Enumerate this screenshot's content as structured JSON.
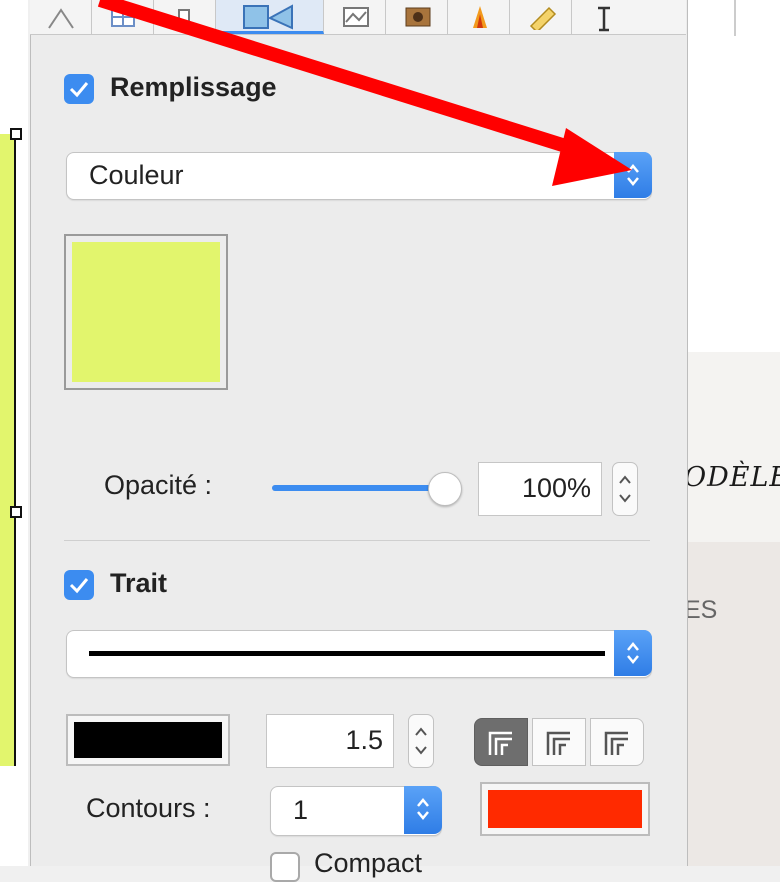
{
  "fill": {
    "enabled": true,
    "section_label": "Remplissage",
    "type_popup_value": "Couleur",
    "swatch_color": "#e2f56d",
    "opacity_label": "Opacité :",
    "opacity_value": "100%",
    "opacity_level": 1.0
  },
  "stroke": {
    "enabled": true,
    "section_label": "Trait",
    "style_popup": "solid-line",
    "color": "#000000",
    "width_value": "1.5",
    "alignment_options": [
      "inner-stroke-icon",
      "center-stroke-icon",
      "outer-stroke-icon"
    ],
    "selected_alignment": "inner-stroke-icon",
    "contours_label": "Contours :",
    "contours_value": "1",
    "contours_color": "#ff2a00"
  },
  "compact_label": "Compact",
  "background_document": {
    "title_fragment": "ODÈLE",
    "subtitle_fragment": "ES"
  },
  "toolbar_icons": [
    "shape-icon",
    "grid-icon",
    "fill-stroke-icon",
    "image-icon",
    "photo-icon",
    "effects-icon",
    "ruler-icon",
    "text-icon"
  ],
  "annotation": {
    "arrow_color": "#ff0000"
  },
  "colors": {
    "accent": "#3c8cf0",
    "panel": "#ececec"
  }
}
